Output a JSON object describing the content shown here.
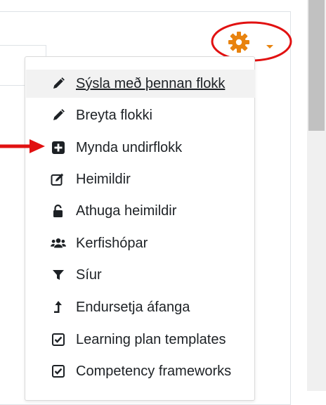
{
  "settings_menu": {
    "gear_icon": "gear-icon",
    "accent_color": "#e8830f",
    "items": [
      {
        "label": "Sýsla með þennan flokk",
        "icon": "pencil-icon"
      },
      {
        "label": "Breyta flokki",
        "icon": "pencil-icon"
      },
      {
        "label": "Mynda undirflokk",
        "icon": "plus-square-icon"
      },
      {
        "label": "Heimildir",
        "icon": "edit-square-icon"
      },
      {
        "label": "Athuga heimildir",
        "icon": "unlock-icon"
      },
      {
        "label": "Kerfishópar",
        "icon": "users-icon"
      },
      {
        "label": "Síur",
        "icon": "filter-icon"
      },
      {
        "label": "Endursetja áfanga",
        "icon": "level-up-icon"
      },
      {
        "label": "Learning plan templates",
        "icon": "check-square-icon"
      },
      {
        "label": "Competency frameworks",
        "icon": "check-square-icon"
      }
    ]
  },
  "annotations": {
    "highlight_color": "#e11111"
  }
}
